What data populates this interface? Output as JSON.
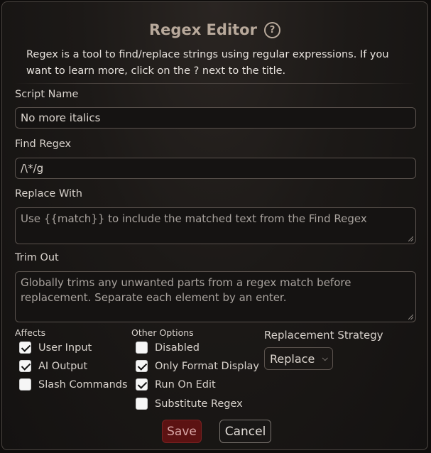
{
  "dialog": {
    "title": "Regex Editor",
    "help_symbol": "?",
    "description": "Regex is a tool to find/replace strings using regular expressions. If you want to learn more, click on the ? next to the title."
  },
  "fields": {
    "script_name": {
      "label": "Script Name",
      "value": "No more italics"
    },
    "find_regex": {
      "label": "Find Regex",
      "value": "/\\*/g"
    },
    "replace_with": {
      "label": "Replace With",
      "placeholder": "Use {{match}} to include the matched text from the Find Regex"
    },
    "trim_out": {
      "label": "Trim Out",
      "placeholder": "Globally trims any unwanted parts from a regex match before replacement. Separate each element by an enter."
    }
  },
  "affects": {
    "heading": "Affects",
    "options": [
      {
        "label": "User Input",
        "checked": true
      },
      {
        "label": "AI Output",
        "checked": true
      },
      {
        "label": "Slash Commands",
        "checked": false
      }
    ]
  },
  "other_options": {
    "heading": "Other Options",
    "options": [
      {
        "label": "Disabled",
        "checked": false
      },
      {
        "label": "Only Format Display",
        "checked": true
      },
      {
        "label": "Run On Edit",
        "checked": true
      },
      {
        "label": "Substitute Regex",
        "checked": false
      }
    ]
  },
  "replacement_strategy": {
    "label": "Replacement Strategy",
    "selected": "Replace"
  },
  "buttons": {
    "save": "Save",
    "cancel": "Cancel"
  },
  "colors": {
    "save_bg": "#5c1212",
    "title": "#b8a99b",
    "background": "#1c1917"
  }
}
